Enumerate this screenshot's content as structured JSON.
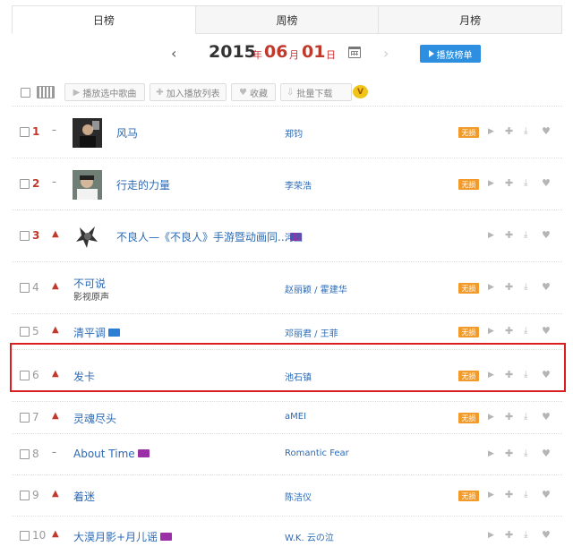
{
  "tabs": [
    {
      "label": "日榜",
      "active": true
    },
    {
      "label": "周榜",
      "active": false
    },
    {
      "label": "月榜",
      "active": false
    }
  ],
  "date": {
    "year": "2015",
    "year_unit": "年",
    "month": "06",
    "month_unit": "月",
    "day": "01",
    "day_unit": "日"
  },
  "date_nav": {
    "prev_icon": "chevron-left-icon",
    "next_icon": "chevron-right-icon",
    "calendar_icon": "calendar-icon"
  },
  "play_list_label": "播放榜单",
  "toolbar": {
    "play_selected": "播放选中歌曲",
    "add_to_list": "加入播放列表",
    "favorite": "收藏",
    "batch_download": "批量下载",
    "vip_badge": "V"
  },
  "lossless_label": "无损",
  "songs": [
    {
      "rank": "1",
      "trend": "same",
      "title": "风马",
      "subtitle": "",
      "artist": "郑钧",
      "lossless": true,
      "mv": "",
      "cover": "dark-portrait"
    },
    {
      "rank": "2",
      "trend": "same",
      "title": "行走的力量",
      "subtitle": "",
      "artist": "李荣浩",
      "lossless": true,
      "mv": "",
      "cover": "portrait"
    },
    {
      "rank": "3",
      "trend": "up",
      "title": "不良人—《不良人》手游暨动画同...",
      "subtitle": "",
      "artist": "河图",
      "lossless": false,
      "mv": "purple",
      "cover": "cartoon"
    },
    {
      "rank": "4",
      "trend": "up",
      "title": "不可说",
      "subtitle": "影视原声",
      "artist": "赵丽颖 / 霍建华",
      "lossless": true,
      "mv": "",
      "cover": ""
    },
    {
      "rank": "5",
      "trend": "up",
      "title": "清平调",
      "subtitle": "",
      "artist": "邓丽君 / 王菲",
      "lossless": true,
      "mv": "blue",
      "cover": ""
    },
    {
      "rank": "6",
      "trend": "up",
      "title": "发卡",
      "subtitle": "",
      "artist": "池石镇",
      "lossless": true,
      "mv": "",
      "cover": ""
    },
    {
      "rank": "7",
      "trend": "up",
      "title": "灵魂尽头",
      "subtitle": "",
      "artist": "aMEI",
      "lossless": true,
      "mv": "",
      "cover": ""
    },
    {
      "rank": "8",
      "trend": "same",
      "title": "About Time",
      "subtitle": "",
      "artist": "Romantic Fear",
      "lossless": false,
      "mv": "purple",
      "cover": ""
    },
    {
      "rank": "9",
      "trend": "up",
      "title": "着迷",
      "subtitle": "",
      "artist": "陈洁仪",
      "lossless": true,
      "mv": "",
      "cover": ""
    },
    {
      "rank": "10",
      "trend": "up",
      "title": "大漠月影+月儿谣",
      "subtitle": "",
      "artist": "W.K. 云の泣",
      "lossless": false,
      "mv": "purple",
      "cover": ""
    }
  ],
  "row_actions": [
    "play-icon",
    "add-icon",
    "download-icon",
    "heart-icon"
  ]
}
